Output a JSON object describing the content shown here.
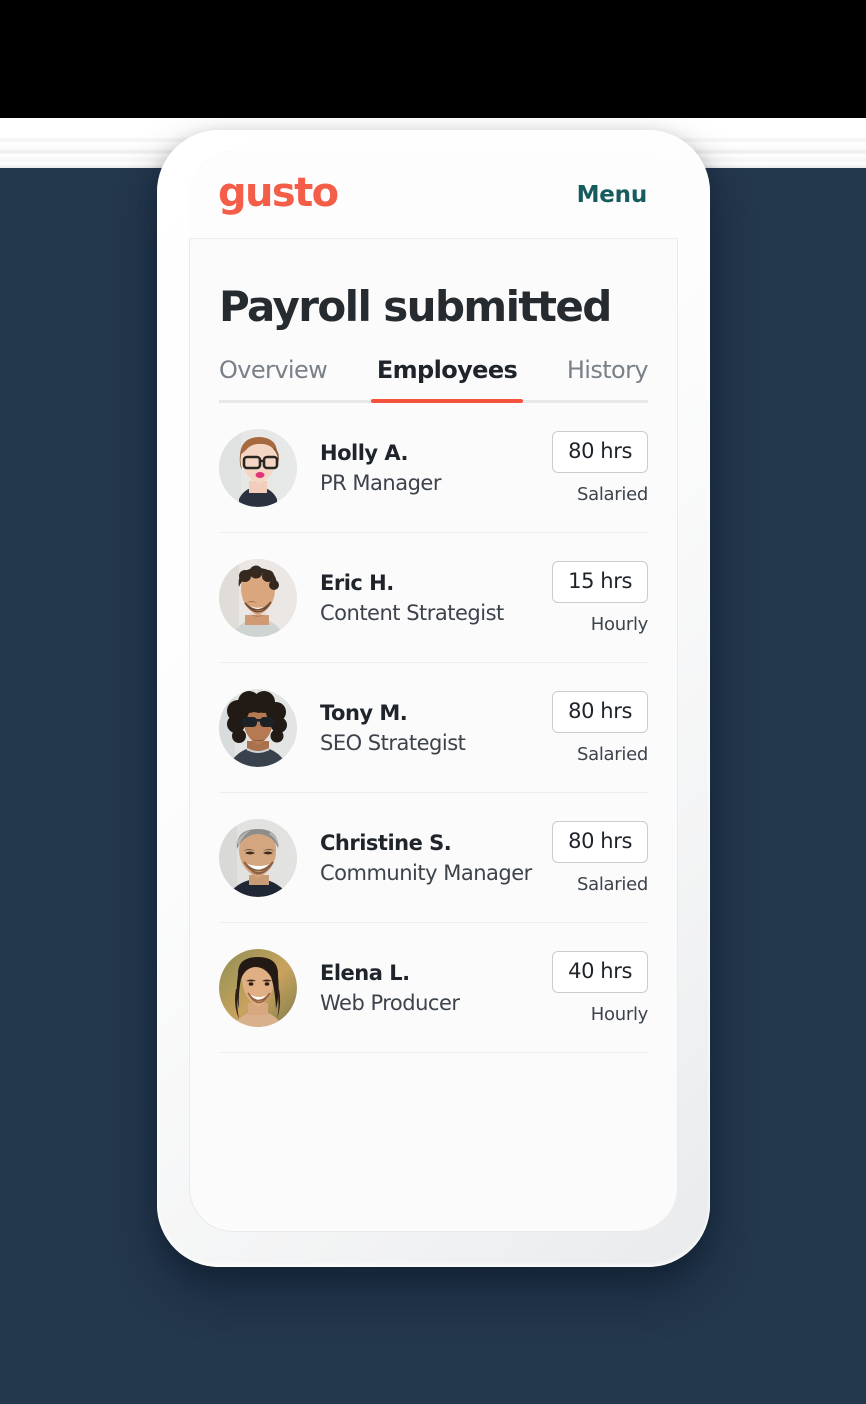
{
  "theme": {
    "background_navy": "#23374D",
    "brand_coral": "#F45D48",
    "accent_underline": "#F4523C",
    "menu_teal": "#165B5E",
    "screen_bg": "#FBFBFC"
  },
  "appbar": {
    "logo_text": "gusto",
    "menu_label": "Menu"
  },
  "page": {
    "title": "Payroll submitted"
  },
  "tabs": [
    {
      "label": "Overview",
      "active": false
    },
    {
      "label": "Employees",
      "active": true
    },
    {
      "label": "History",
      "active": false
    }
  ],
  "employees": [
    {
      "name": "Holly A.",
      "role": "PR Manager",
      "hours": "80 hrs",
      "pay_type": "Salaried",
      "avatar": "avatar-holly"
    },
    {
      "name": "Eric H.",
      "role": "Content Strategist",
      "hours": "15 hrs",
      "pay_type": "Hourly",
      "avatar": "avatar-eric"
    },
    {
      "name": "Tony M.",
      "role": "SEO Strategist",
      "hours": "80 hrs",
      "pay_type": "Salaried",
      "avatar": "avatar-tony"
    },
    {
      "name": "Christine S.",
      "role": "Community Manager",
      "hours": "80 hrs",
      "pay_type": "Salaried",
      "avatar": "avatar-christine"
    },
    {
      "name": "Elena L.",
      "role": "Web Producer",
      "hours": "40 hrs",
      "pay_type": "Hourly",
      "avatar": "avatar-elena"
    }
  ]
}
